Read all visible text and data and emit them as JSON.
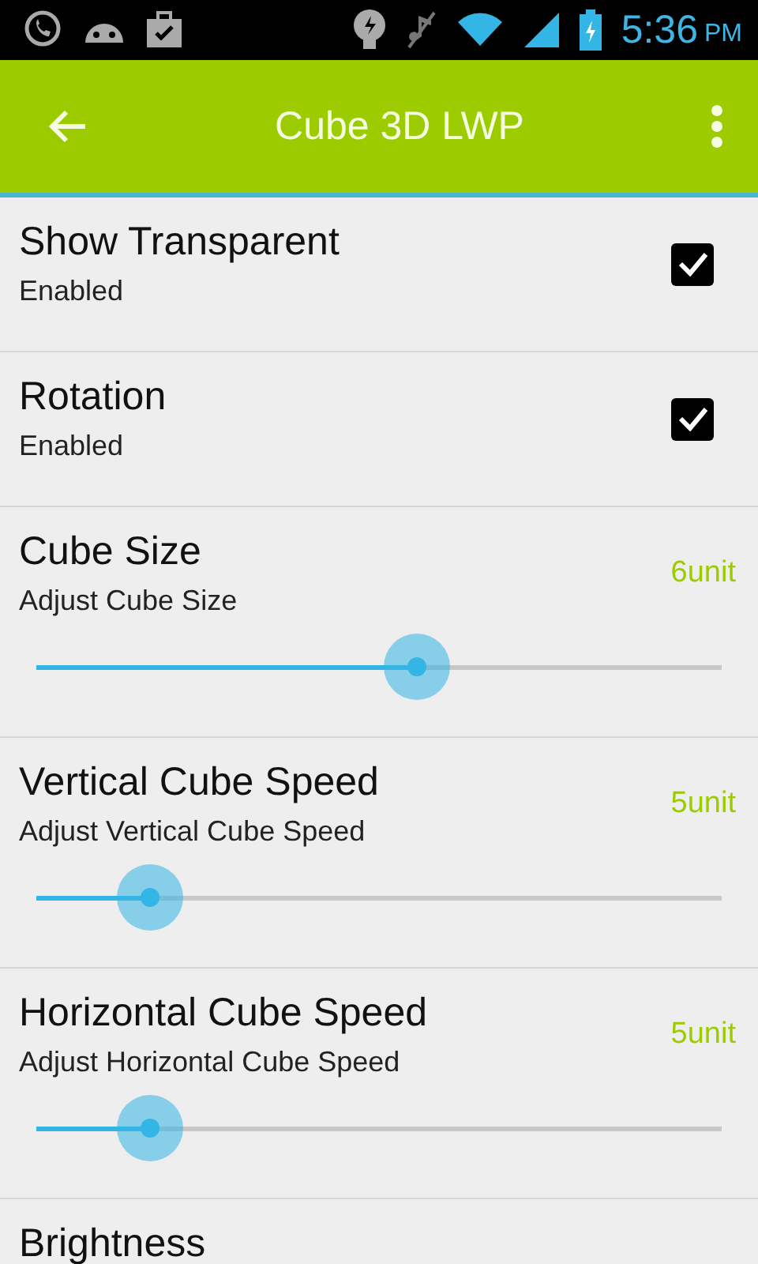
{
  "status_bar": {
    "time": "5:36",
    "meridiem": "PM"
  },
  "toolbar": {
    "title": "Cube 3D LWP"
  },
  "settings": [
    {
      "kind": "checkbox",
      "title": "Show Transparent",
      "summary": "Enabled",
      "checked": true
    },
    {
      "kind": "checkbox",
      "title": "Rotation",
      "summary": "Enabled",
      "checked": true
    },
    {
      "kind": "slider",
      "title": "Cube Size",
      "summary": "Adjust Cube Size",
      "value": "6unit",
      "level": 0.555
    },
    {
      "kind": "slider",
      "title": "Vertical Cube Speed",
      "summary": "Adjust Vertical Cube Speed",
      "value": "5unit",
      "level": 0.166
    },
    {
      "kind": "slider",
      "title": "Horizontal Cube Speed",
      "summary": "Adjust Horizontal Cube Speed",
      "value": "5unit",
      "level": 0.166
    },
    {
      "kind": "header",
      "title": "Brightness"
    }
  ]
}
